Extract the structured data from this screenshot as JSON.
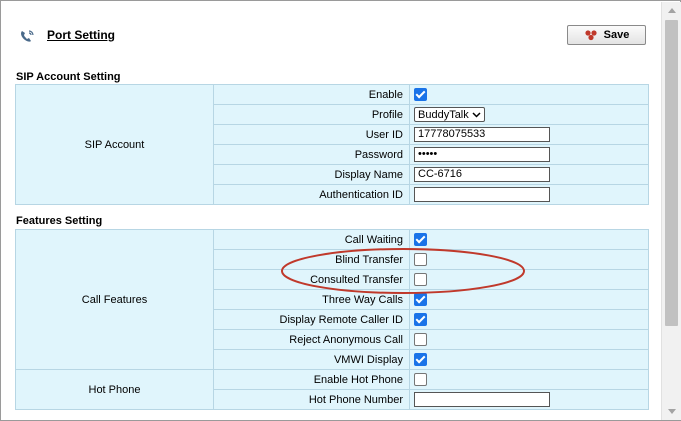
{
  "header": {
    "title": "Port Setting",
    "save_label": "Save"
  },
  "sip_section": {
    "title": "SIP Account Setting",
    "group_label": "SIP Account",
    "rows": {
      "enable": {
        "label": "Enable",
        "checked": true
      },
      "profile": {
        "label": "Profile",
        "value": "BuddyTalk"
      },
      "user_id": {
        "label": "User ID",
        "value": "17778075533"
      },
      "password": {
        "label": "Password",
        "value": "•••••"
      },
      "display_name": {
        "label": "Display Name",
        "value": "CC-6716"
      },
      "auth_id": {
        "label": "Authentication ID",
        "value": ""
      }
    }
  },
  "features_section": {
    "title": "Features Setting",
    "call_features_label": "Call Features",
    "hot_phone_label": "Hot Phone",
    "rows": {
      "call_waiting": {
        "label": "Call Waiting",
        "checked": true
      },
      "blind_transfer": {
        "label": "Blind Transfer",
        "checked": false
      },
      "consulted_transfer": {
        "label": "Consulted Transfer",
        "checked": false
      },
      "three_way_calls": {
        "label": "Three Way Calls",
        "checked": true
      },
      "display_remote_caller_id": {
        "label": "Display Remote Caller ID",
        "checked": true
      },
      "reject_anonymous_call": {
        "label": "Reject Anonymous Call",
        "checked": false
      },
      "vmwi_display": {
        "label": "VMWI Display",
        "checked": true
      },
      "enable_hot_phone": {
        "label": "Enable Hot Phone",
        "checked": false
      },
      "hot_phone_number": {
        "label": "Hot Phone Number",
        "value": ""
      }
    }
  },
  "colors": {
    "row_bg": "#e0f5fc",
    "row_border": "#b7d6e4",
    "checkbox_on": "#1a73e8",
    "highlight": "#c0392b"
  }
}
